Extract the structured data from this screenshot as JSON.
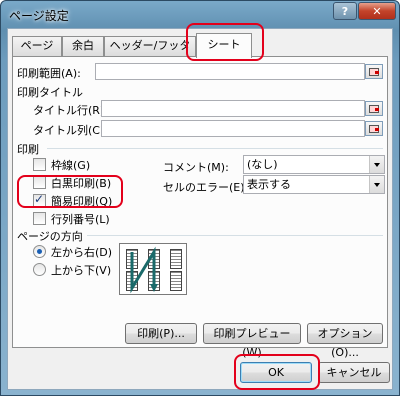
{
  "window": {
    "title": "ページ設定",
    "help_label": "?",
    "close_label": "✕"
  },
  "tabs": [
    {
      "label": "ページ",
      "active": false
    },
    {
      "label": "余白",
      "active": false
    },
    {
      "label": "ヘッダー/フッター",
      "active": false
    },
    {
      "label": "シート",
      "active": true
    }
  ],
  "print_area": {
    "label": "印刷範囲(A):",
    "value": ""
  },
  "print_titles": {
    "heading": "印刷タイトル",
    "rows_label": "タイトル行(R):",
    "rows_value": "",
    "cols_label": "タイトル列(C):",
    "cols_value": ""
  },
  "print": {
    "heading": "印刷",
    "gridlines": {
      "label": "枠線(G)",
      "checked": false
    },
    "bw": {
      "label": "白黒印刷(B)",
      "checked": false
    },
    "draft": {
      "label": "簡易印刷(Q)",
      "checked": true
    },
    "headings": {
      "label": "行列番号(L)",
      "checked": false
    },
    "comments_label": "コメント(M):",
    "comments_value": "(なし)",
    "errors_label": "セルのエラー(E):",
    "errors_value": "表示する"
  },
  "page_order": {
    "heading": "ページの方向",
    "down_then_over": {
      "label": "左から右(D)",
      "checked": true
    },
    "over_then_down": {
      "label": "上から下(V)",
      "checked": false
    }
  },
  "buttons": {
    "print": "印刷(P)...",
    "preview": "印刷プレビュー(W)",
    "options": "オプション(O)...",
    "ok": "OK",
    "cancel": "キャンセル"
  },
  "colors": {
    "highlight": "#e3001b",
    "accent": "#1a5fb4"
  }
}
